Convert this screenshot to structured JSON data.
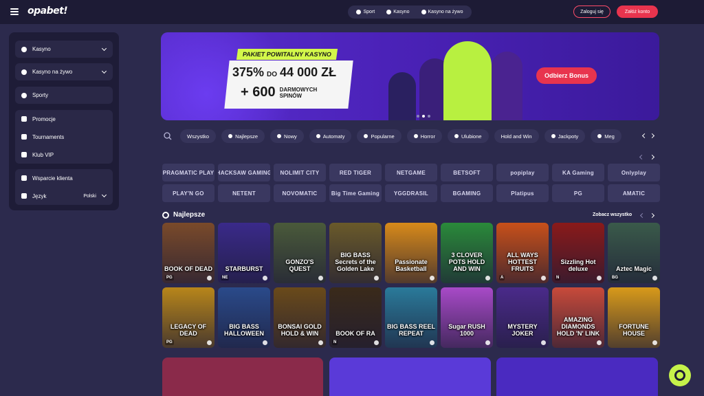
{
  "header": {
    "logo": "opabet!",
    "nav": [
      {
        "label": "Sport",
        "icon": "football-icon"
      },
      {
        "label": "Kasyno",
        "icon": "casino-chip-icon"
      },
      {
        "label": "Kasyno na żywo",
        "icon": "cards-icon"
      }
    ],
    "login_label": "Zaloguj się",
    "register_label": "Załóż konto"
  },
  "sidebar": {
    "items": [
      {
        "label": "Kasyno",
        "icon": "casino-chip-icon"
      },
      {
        "label": "Kasyno na żywo",
        "icon": "cards-icon"
      },
      {
        "label": "Sporty",
        "icon": "football-icon"
      }
    ],
    "group1": [
      {
        "label": "Promocje",
        "icon": "megaphone-icon"
      },
      {
        "label": "Tournaments",
        "icon": "trophy-icon"
      },
      {
        "label": "Klub VIP",
        "icon": "user-icon"
      }
    ],
    "group2": [
      {
        "label": "Wsparcie klienta",
        "icon": "support-icon"
      },
      {
        "label": "Język",
        "icon": "globe-icon",
        "value": "Polski"
      }
    ]
  },
  "banner": {
    "tag": "PAKIET POWITALNY KASYNO",
    "pct": "375%",
    "do": "DO",
    "amount": "44 000 ZŁ",
    "spins_big": "+ 600",
    "spins_text": "DARMOWYCH SPINÓW",
    "cta": "Odbierz Bonus"
  },
  "categories": [
    "Wszystko",
    "Najlepsze",
    "Nowy",
    "Automaty",
    "Popularne",
    "Horror",
    "Ulubione",
    "Hold and Win",
    "Jackpoty",
    "Meg"
  ],
  "providers": [
    "PRAGMATIC PLAY",
    "HACKSAW GAMING",
    "NOLIMIT CITY",
    "RED TIGER",
    "NETGAME",
    "BETSOFT",
    "popiplay",
    "KA Gaming",
    "Onlyplay",
    "PLAY'N GO",
    "NETENT",
    "NOVOMATIC",
    "Big Time Gaming",
    "YGGDRASIL",
    "BGAMING",
    "Platipus",
    "PG",
    "AMATIC"
  ],
  "section": {
    "title": "Najlepsze",
    "see_all": "Zobacz wszystko"
  },
  "games": [
    {
      "title": "BOOK OF DEAD",
      "color": "#7a4a2a",
      "badge": "PG"
    },
    {
      "title": "STARBURST",
      "color": "#3a2a8a",
      "badge": "NE"
    },
    {
      "title": "GONZO'S QUEST",
      "color": "#4a5a3a",
      "badge": ""
    },
    {
      "title": "BIG BASS Secrets of the Golden Lake",
      "color": "#6a5a2a",
      "badge": ""
    },
    {
      "title": "Passionate Basketball",
      "color": "#d88a1a",
      "badge": ""
    },
    {
      "title": "3 CLOVER POTS HOLD AND WIN",
      "color": "#2a8a3a",
      "badge": ""
    },
    {
      "title": "ALL WAYS HOTTEST FRUITS",
      "color": "#c8501a",
      "badge": "A"
    },
    {
      "title": "Sizzling Hot deluxe",
      "color": "#8a1a1a",
      "badge": "N"
    },
    {
      "title": "Aztec Magic",
      "color": "#3a5a4a",
      "badge": "BG"
    },
    {
      "title": "LEGACY OF DEAD",
      "color": "#b8861a",
      "badge": "PG"
    },
    {
      "title": "BIG BASS HALLOWEEN",
      "color": "#2a4a8a",
      "badge": ""
    },
    {
      "title": "BONSAI GOLD HOLD & WIN",
      "color": "#6a4a1a",
      "badge": ""
    },
    {
      "title": "BOOK OF RA",
      "color": "#3a2a1a",
      "badge": "N"
    },
    {
      "title": "BIG BASS REEL REPEAT",
      "color": "#2a7a9a",
      "badge": ""
    },
    {
      "title": "Sugar RUSH 1000",
      "color": "#a84ac8",
      "badge": ""
    },
    {
      "title": "MYSTERY JOKER",
      "color": "#4a2a8a",
      "badge": ""
    },
    {
      "title": "AMAZING DIAMONDS HOLD 'N' LINK",
      "color": "#c84a3a",
      "badge": ""
    },
    {
      "title": "FORTUNE HOUSE",
      "color": "#d89a1a",
      "badge": ""
    }
  ],
  "colors": {
    "accent": "#e8344e",
    "brand_green": "#c6f24a",
    "bg": "#2c2a4d"
  }
}
